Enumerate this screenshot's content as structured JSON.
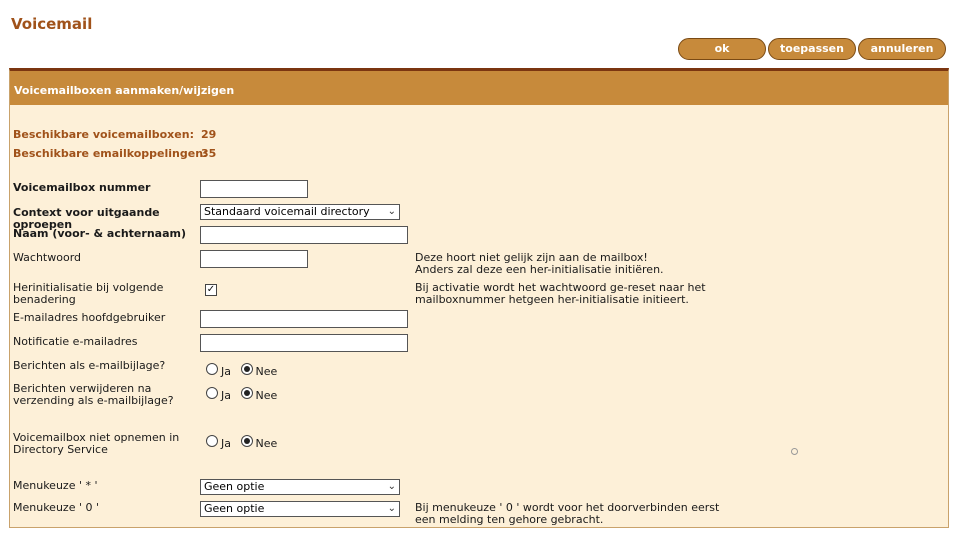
{
  "page": {
    "title": "Voicemail"
  },
  "toolbar": {
    "ok_label": "ok",
    "apply_label": "toepassen",
    "cancel_label": "annuleren"
  },
  "panel": {
    "header": "Voicemailboxen aanmaken/wijzigen"
  },
  "availability": {
    "mailboxes_label": "Beschikbare voicemailboxen:",
    "mailboxes_value": "29",
    "email_label": "Beschikbare emailkoppelingen:",
    "email_value": "35"
  },
  "form": {
    "mailbox_number_label": "Voicemailbox nummer",
    "mailbox_number_value": "",
    "context_label": "Context voor uitgaande oproepen",
    "context_value": "Standaard voicemail directory",
    "name_label": "Naam (voor- & achternaam)",
    "name_value": "",
    "password_label": "Wachtwoord",
    "password_value": "",
    "password_note_1": "Deze hoort niet gelijk zijn aan de mailbox!",
    "password_note_2": "Anders zal deze een her-initialisatie initiëren.",
    "reinit_label_1": "Herinitialisatie bij volgende",
    "reinit_label_2": "benadering",
    "reinit_checked": true,
    "reinit_checkmark": "✓",
    "reinit_note_1": "Bij activatie wordt het wachtwoord ge-reset naar het",
    "reinit_note_2": "mailboxnummer hetgeen her-initialisatie initieert.",
    "email_main_label": "E-mailadres hoofdgebruiker",
    "email_main_value": "",
    "notify_email_label": "Notificatie e-mailadres",
    "notify_email_value": "",
    "attach_label": "Berichten als e-mailbijlage?",
    "delete_label_1": "Berichten verwijderen na",
    "delete_label_2": "verzending als e-mailbijlage?",
    "directory_label_1": "Voicemailbox niet opnemen in",
    "directory_label_2": "Directory Service",
    "option_yes": "Ja",
    "option_no": "Nee",
    "menu_star_label": "Menukeuze  ' * '",
    "menu_star_value": "Geen optie",
    "menu_zero_label": "Menukeuze  ' 0 '",
    "menu_zero_value": "Geen optie",
    "menu_zero_note_1": "Bij menukeuze ' 0 ' wordt voor het doorverbinden eerst",
    "menu_zero_note_2": "een melding ten gehore gebracht."
  },
  "icons": {
    "dropdown": "chevron-down-icon",
    "checkbox_check": "check-icon"
  },
  "colors": {
    "title": "#a0521a",
    "button": "#c78a3b",
    "panel_header": "#c78a3b",
    "panel_bg": "#fdf0d8",
    "panel_top_border": "#7b3510"
  }
}
